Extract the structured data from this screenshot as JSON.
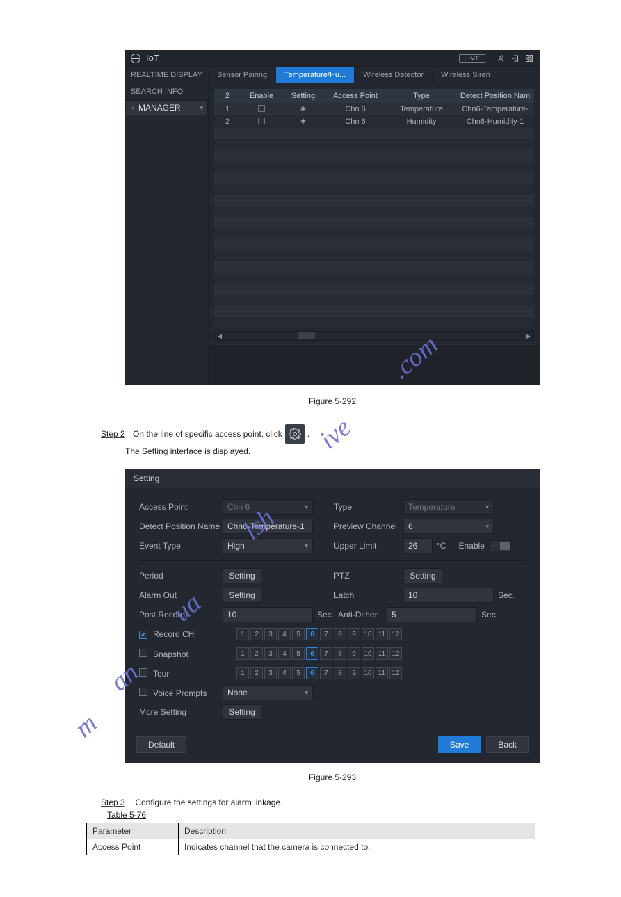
{
  "iot": {
    "title": "IoT",
    "live": "LIVE",
    "sidebar": [
      "REALTIME DISPLAY",
      "SEARCH INFO",
      "MANAGER"
    ],
    "tabs": [
      "Sensor Pairing",
      "Temperature/Hu...",
      "Wireless Detector",
      "Wireless Siren"
    ],
    "headers": [
      "2",
      "Enable",
      "Setting",
      "Access Point",
      "Type",
      "Detect Position Nam"
    ],
    "rows": [
      {
        "n": "1",
        "ap": "Chn 6",
        "type": "Temperature",
        "pos": "Chn6-Temperature-"
      },
      {
        "n": "2",
        "ap": "Chn 6",
        "type": "Humidity",
        "pos": "Chn6-Humidity-1"
      }
    ]
  },
  "caption1": "Figure 5-292",
  "step2": {
    "label": "Step 2",
    "text1": "On the line of specific access point, click ",
    "text2": ".",
    "sub": "The Setting interface is displayed."
  },
  "setting": {
    "title": "Setting",
    "accessPoint": {
      "lbl": "Access Point",
      "val": "Chn 6"
    },
    "type": {
      "lbl": "Type",
      "val": "Temperature"
    },
    "detect": {
      "lbl": "Detect Position Name",
      "val": "Chn6-Temperature-1"
    },
    "preview": {
      "lbl": "Preview Channel",
      "val": "6"
    },
    "event": {
      "lbl": "Event Type",
      "val": "High"
    },
    "upper": {
      "lbl": "Upper Limit",
      "val": "26",
      "unit": "°C"
    },
    "enable": "Enable",
    "period": {
      "lbl": "Period",
      "btn": "Setting"
    },
    "ptz": {
      "lbl": "PTZ",
      "btn": "Setting"
    },
    "alarm": {
      "lbl": "Alarm Out",
      "btn": "Setting"
    },
    "latch": {
      "lbl": "Latch",
      "val": "10",
      "unit": "Sec."
    },
    "post": {
      "lbl": "Post Record",
      "val": "10",
      "unit": "Sec."
    },
    "anti": {
      "lbl": "Anti-Dither",
      "val": "5",
      "unit": "Sec."
    },
    "record": {
      "lbl": "Record CH"
    },
    "snapshot": {
      "lbl": "Snapshot"
    },
    "tour": {
      "lbl": "Tour"
    },
    "voice": {
      "lbl": "Voice Prompts",
      "val": "None"
    },
    "more": {
      "lbl": "More Setting",
      "btn": "Setting"
    },
    "channels": [
      "1",
      "2",
      "3",
      "4",
      "5",
      "6",
      "7",
      "8",
      "9",
      "10",
      "11",
      "12"
    ],
    "defaultBtn": "Default",
    "save": "Save",
    "back": "Back"
  },
  "caption2": "Figure 5-293",
  "step3": {
    "label": "Step 3",
    "text": "Configure the settings for alarm linkage."
  },
  "tablelabel": "Table 5-76",
  "paramTable": {
    "h1": "Parameter",
    "h2": "Description",
    "r1c1": "Access Point",
    "r1c2": "Indicates channel that the camera is connected to."
  }
}
